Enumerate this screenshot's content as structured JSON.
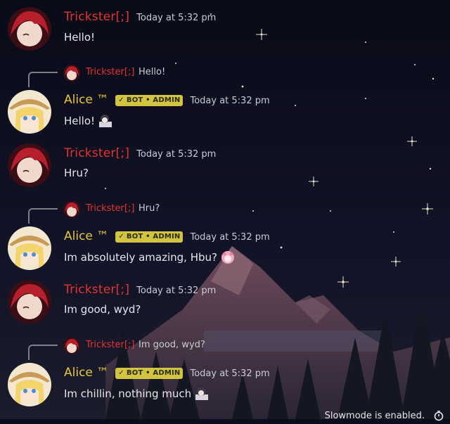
{
  "users": {
    "trickster": "Trickster[;]",
    "alice": "Alice ™"
  },
  "badge": {
    "check": "✓",
    "label": "BOT • ADMIN"
  },
  "messages": [
    {
      "author": "Trickster[;]",
      "time": "Today at 5:32 pm",
      "text": "Hello!"
    },
    {
      "reply_author": "Trickster[;]",
      "reply_text": "Hello!",
      "author": "Alice ™",
      "time": "Today at 5:32 pm",
      "text": "Hello!",
      "emote": "anime-girl-emote"
    },
    {
      "author": "Trickster[;]",
      "time": "Today at 5:32 pm",
      "text": "Hru?"
    },
    {
      "reply_author": "Trickster[;]",
      "reply_text": "Hru?",
      "author": "Alice ™",
      "time": "Today at 5:32 pm",
      "text": "Im absolutely amazing, Hbu?",
      "emote": "pink-hair-emote"
    },
    {
      "author": "Trickster[;]",
      "time": "Today at 5:32 pm",
      "text": "Im good, wyd?"
    },
    {
      "reply_author": "Trickster[;]",
      "reply_text": "Im good, wyd?",
      "author": "Alice ™",
      "time": "Today at 5:32 pm",
      "text": "Im chillin, nothing much",
      "emote": "anime-girl-emote"
    }
  ],
  "footer": {
    "slowmode": "Slowmode is enabled.",
    "icon": "timer-icon"
  },
  "colors": {
    "trickster": "#e5342f",
    "alice": "#e6c83a",
    "badge": "#d2c441",
    "background": "#0c0d1c"
  }
}
